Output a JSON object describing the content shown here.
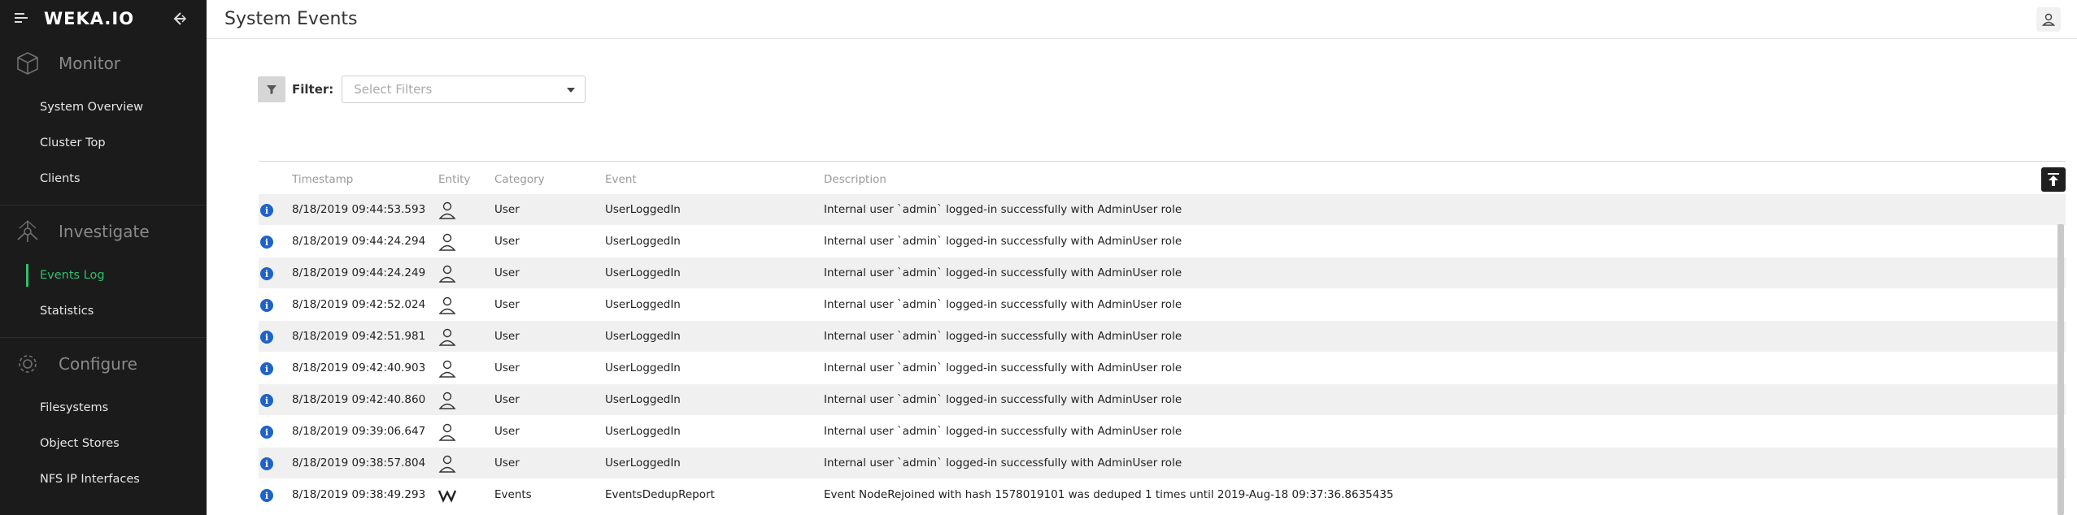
{
  "app": {
    "logo_text": "WEKA.IO"
  },
  "sidebar": {
    "sections": [
      {
        "label": "Monitor",
        "icon": "cube-icon",
        "items": [
          {
            "label": "System Overview",
            "active": false
          },
          {
            "label": "Cluster Top",
            "active": false
          },
          {
            "label": "Clients",
            "active": false
          }
        ]
      },
      {
        "label": "Investigate",
        "icon": "network-icon",
        "items": [
          {
            "label": "Events Log",
            "active": true
          },
          {
            "label": "Statistics",
            "active": false
          }
        ]
      },
      {
        "label": "Configure",
        "icon": "gear-icon",
        "items": [
          {
            "label": "Filesystems",
            "active": false
          },
          {
            "label": "Object Stores",
            "active": false
          },
          {
            "label": "NFS IP Interfaces",
            "active": false
          }
        ]
      }
    ]
  },
  "header": {
    "title": "System Events"
  },
  "filter": {
    "label": "Filter:",
    "placeholder": "Select Filters"
  },
  "table": {
    "columns": [
      "Timestamp",
      "Entity",
      "Category",
      "Event",
      "Description"
    ],
    "rows": [
      {
        "timestamp": "8/18/2019 09:44:53.593",
        "entity": "user-icon",
        "category": "User",
        "event": "UserLoggedIn",
        "description": "Internal user `admin` logged-in successfully with AdminUser role"
      },
      {
        "timestamp": "8/18/2019 09:44:24.294",
        "entity": "user-icon",
        "category": "User",
        "event": "UserLoggedIn",
        "description": "Internal user `admin` logged-in successfully with AdminUser role"
      },
      {
        "timestamp": "8/18/2019 09:44:24.249",
        "entity": "user-icon",
        "category": "User",
        "event": "UserLoggedIn",
        "description": "Internal user `admin` logged-in successfully with AdminUser role"
      },
      {
        "timestamp": "8/18/2019 09:42:52.024",
        "entity": "user-icon",
        "category": "User",
        "event": "UserLoggedIn",
        "description": "Internal user `admin` logged-in successfully with AdminUser role"
      },
      {
        "timestamp": "8/18/2019 09:42:51.981",
        "entity": "user-icon",
        "category": "User",
        "event": "UserLoggedIn",
        "description": "Internal user `admin` logged-in successfully with AdminUser role"
      },
      {
        "timestamp": "8/18/2019 09:42:40.903",
        "entity": "user-icon",
        "category": "User",
        "event": "UserLoggedIn",
        "description": "Internal user `admin` logged-in successfully with AdminUser role"
      },
      {
        "timestamp": "8/18/2019 09:42:40.860",
        "entity": "user-icon",
        "category": "User",
        "event": "UserLoggedIn",
        "description": "Internal user `admin` logged-in successfully with AdminUser role"
      },
      {
        "timestamp": "8/18/2019 09:39:06.647",
        "entity": "user-icon",
        "category": "User",
        "event": "UserLoggedIn",
        "description": "Internal user `admin` logged-in successfully with AdminUser role"
      },
      {
        "timestamp": "8/18/2019 09:38:57.804",
        "entity": "user-icon",
        "category": "User",
        "event": "UserLoggedIn",
        "description": "Internal user `admin` logged-in successfully with AdminUser role"
      },
      {
        "timestamp": "8/18/2019 09:38:49.293",
        "entity": "weka-logo-icon",
        "category": "Events",
        "event": "EventsDedupReport",
        "description": "Event NodeRejoined with hash 1578019101 was deduped 1 times until 2019-Aug-18 09:37:36.8635435"
      }
    ]
  },
  "colors": {
    "accent": "#2fbf6f",
    "sidebar_bg": "#1b1b1b",
    "info": "#1e63c6"
  }
}
